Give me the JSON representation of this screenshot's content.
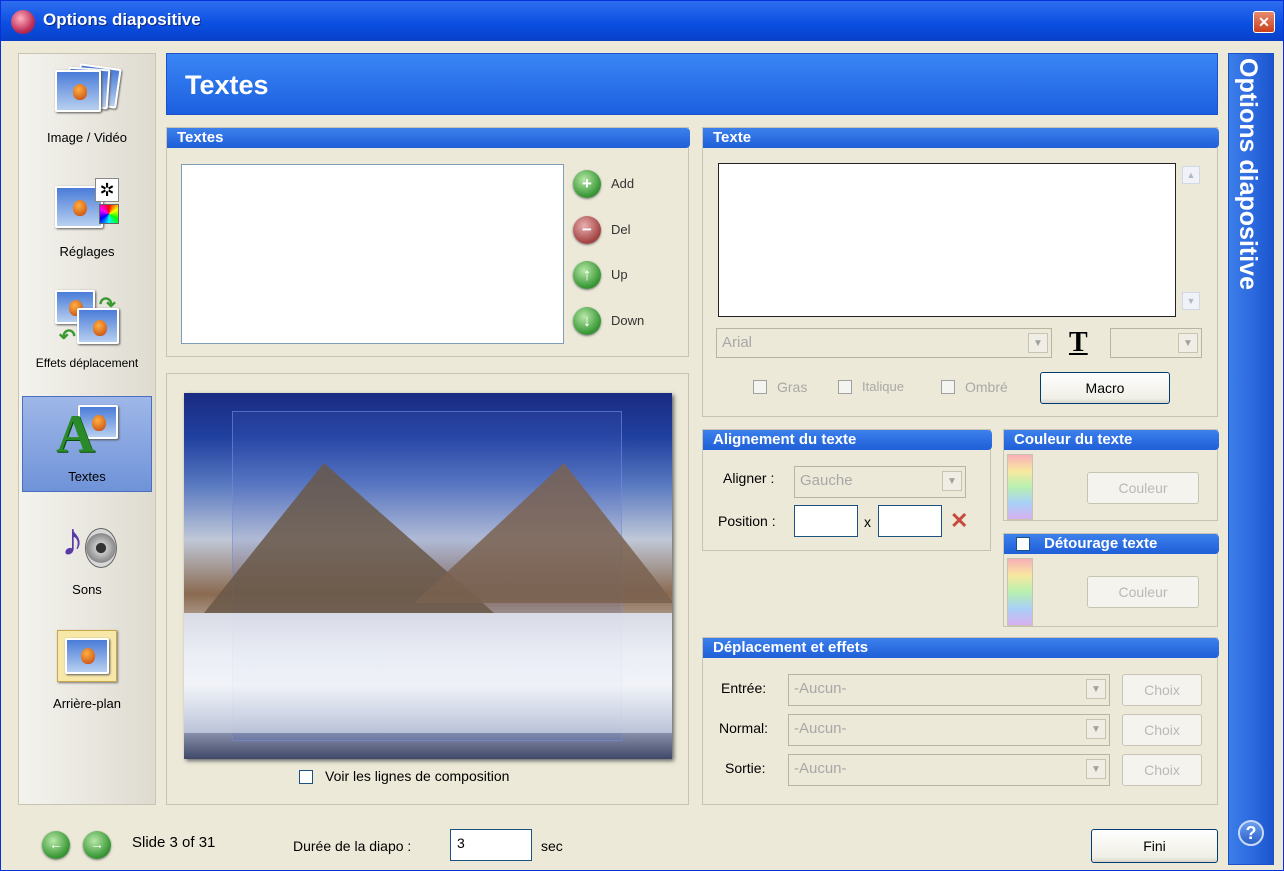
{
  "window": {
    "title": "Options diapositive",
    "close": "✕"
  },
  "sidebar": {
    "items": [
      {
        "label": "Image / Vidéo"
      },
      {
        "label": "Réglages"
      },
      {
        "label": "Effets déplacement"
      },
      {
        "label": "Textes"
      },
      {
        "label": "Sons"
      },
      {
        "label": "Arrière-plan"
      }
    ]
  },
  "header": {
    "title": "Textes"
  },
  "side_band": {
    "title": "Options diapositive",
    "help": "?"
  },
  "textes_group": {
    "title": "Textes",
    "buttons": [
      {
        "label": "Add",
        "glyph": "+"
      },
      {
        "label": "Del",
        "glyph": "−"
      },
      {
        "label": "Up",
        "glyph": "↑"
      },
      {
        "label": "Down",
        "glyph": "↓"
      }
    ]
  },
  "preview": {
    "composition_label": "Voir les lignes de composition"
  },
  "texte_group": {
    "title": "Texte",
    "font": "Arial",
    "size": "",
    "text_icon": "T",
    "bold": "Gras",
    "italic": "Italique",
    "shadow": "Ombré",
    "macro": "Macro"
  },
  "alignement": {
    "title": "Alignement du texte",
    "aligner_label": "Aligner :",
    "aligner_value": "Gauche",
    "position_label": "Position :",
    "x_sep": "x",
    "pos_x": "",
    "pos_y": "",
    "clear_glyph": "✕"
  },
  "couleur": {
    "title": "Couleur du texte",
    "button": "Couleur"
  },
  "detourage": {
    "title": "Détourage texte",
    "button": "Couleur"
  },
  "deplacement": {
    "title": "Déplacement et effets",
    "rows": [
      {
        "label": "Entrée:",
        "value": "-Aucun-",
        "button": "Choix"
      },
      {
        "label": "Normal:",
        "value": "-Aucun-",
        "button": "Choix"
      },
      {
        "label": "Sortie:",
        "value": "-Aucun-",
        "button": "Choix"
      }
    ]
  },
  "footer": {
    "slide_text": "Slide 3 of 31",
    "duree_label": "Durée de la diapo :",
    "duree_value": "3",
    "unit": "sec",
    "fini": "Fini"
  },
  "colors": {
    "accent": "#1f5fd8",
    "titlebar": "#0a4ee0",
    "face": "#ece9d8"
  }
}
